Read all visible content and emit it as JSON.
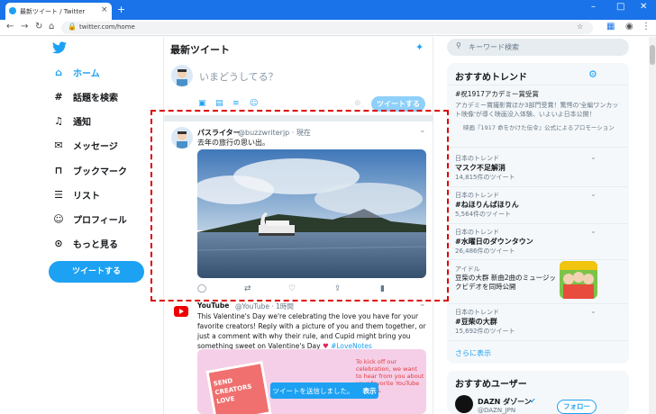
{
  "browser": {
    "tab_title": "最新ツイート / Twitter",
    "url": "twitter.com/home",
    "new_tab": "+",
    "min": "–",
    "max": "□",
    "close": "✕"
  },
  "nav": {
    "items": [
      {
        "label": "ホーム",
        "icon": "home-icon"
      },
      {
        "label": "話題を検索",
        "icon": "hash-icon"
      },
      {
        "label": "通知",
        "icon": "bell-icon"
      },
      {
        "label": "メッセージ",
        "icon": "mail-icon"
      },
      {
        "label": "ブックマーク",
        "icon": "bookmark-icon"
      },
      {
        "label": "リスト",
        "icon": "list-icon"
      },
      {
        "label": "プロフィール",
        "icon": "avatar-icon"
      },
      {
        "label": "もっと見る",
        "icon": "more-icon"
      }
    ],
    "tweet_button": "ツイートする"
  },
  "timeline": {
    "header": "最新ツイート",
    "composer_placeholder": "いまどうしてる？",
    "composer_button": "ツイートする",
    "tweet": {
      "name": "パスライター",
      "handle": "@buzzwriterjp · 現在",
      "text": "去年の旅行の思い出。"
    },
    "yt_tweet": {
      "name": "YouTube",
      "handle": "@YouTube · 1時間",
      "text": "This Valentine's Day we're celebrating the love you have for your favorite creators! Reply with a picture of you and them together, or just a comment with why their rule, and Cupid might bring you something sweet on Valentine's Day",
      "hashtag": "#LoveNotes",
      "promo_left": "SEND CREATORS LOVE",
      "promo_right": "To kick off our celebration, we want to hear from you about your favorite YouTube creators."
    },
    "toast_text": "ツイートを送信しました。",
    "toast_link": "表示"
  },
  "sidebar": {
    "search_placeholder": "キーワード検索",
    "trends_title": "おすすめトレンド",
    "trends": [
      {
        "meta": "",
        "title": "#祝1917アカデミー賞受賞",
        "desc": "アカデミー賞撮影賞ほか3部門受賞！驚愕の'全編ワンカット映像'が導く映画没入体験、いよいよ日本公開！",
        "promo": "映画『1917 命をかけた伝令』公式によるプロモーション"
      },
      {
        "meta": "日本のトレンド",
        "title": "マスク不足解消",
        "count": "14,815件のツイート"
      },
      {
        "meta": "日本のトレンド",
        "title": "#ねほりんぱほりん",
        "count": "5,564件のツイート"
      },
      {
        "meta": "日本のトレンド",
        "title": "#水曜日のダウンタウン",
        "count": "26,486件のツイート"
      },
      {
        "meta": "アイドル",
        "title": "",
        "desc": "豆柴の大群 新曲2曲のミュージックビデオを同時公開"
      },
      {
        "meta": "日本のトレンド",
        "title": "#豆柴の大群",
        "count": "15,692件のツイート"
      }
    ],
    "show_more": "さらに表示",
    "users_title": "おすすめユーザー",
    "user_name": "DAZN ダゾーン",
    "user_handle": "@DAZN_JPN",
    "follow": "フォロー"
  }
}
